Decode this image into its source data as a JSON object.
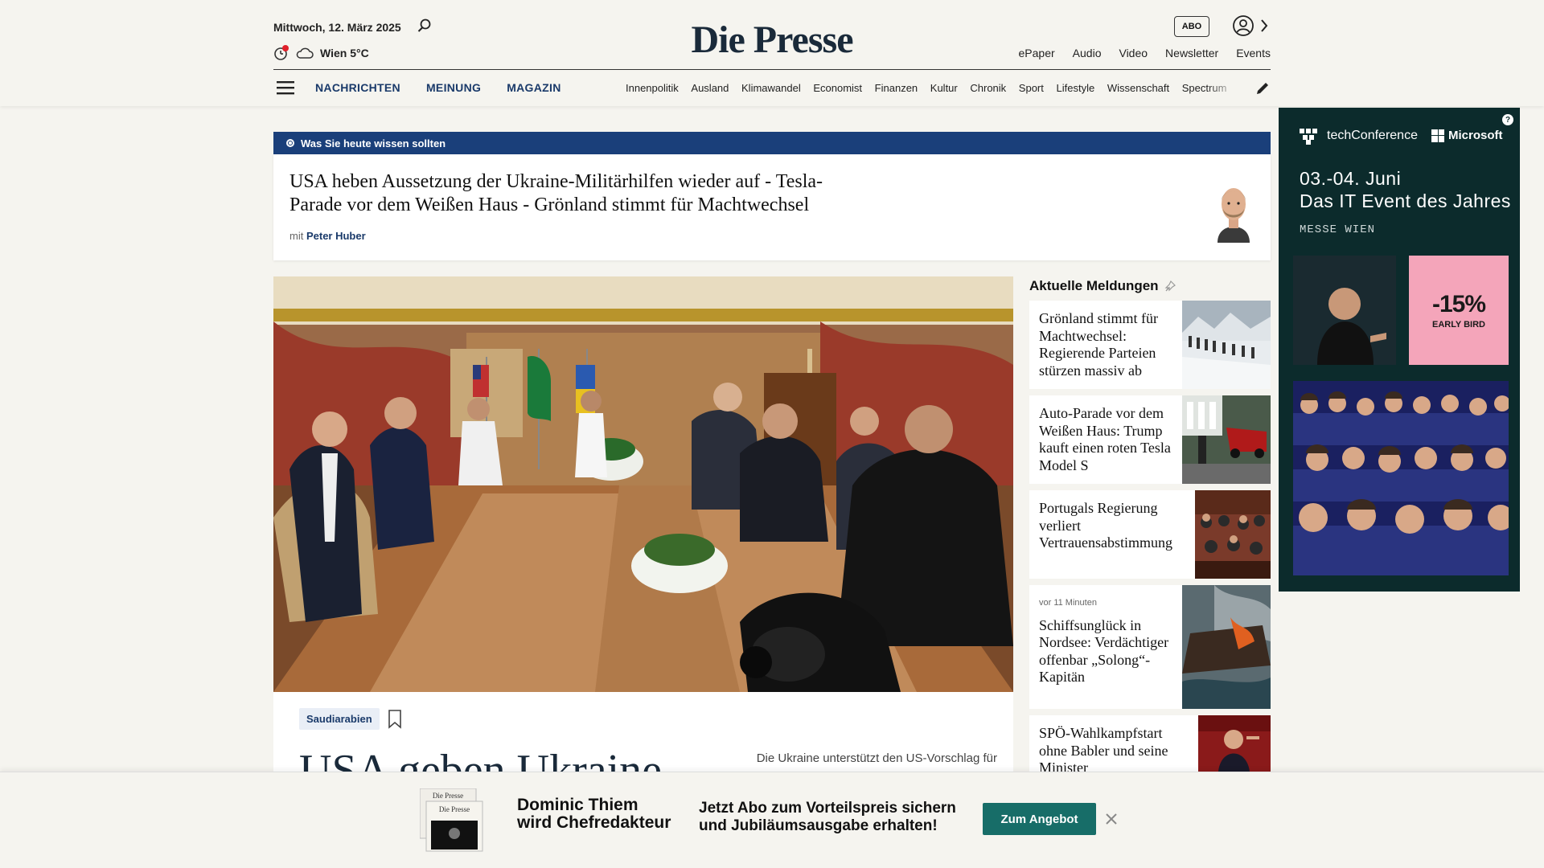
{
  "header": {
    "date": "Mittwoch, 12. März 2025",
    "weather": "Wien 5°C",
    "logo": "Die Presse",
    "abo": "ABO",
    "top_links": [
      "ePaper",
      "Audio",
      "Video",
      "Newsletter",
      "Events"
    ],
    "main_nav": [
      "NACHRICHTEN",
      "MEINUNG",
      "MAGAZIN"
    ],
    "sub_nav": [
      "Innenpolitik",
      "Ausland",
      "Klimawandel",
      "Economist",
      "Finanzen",
      "Kultur",
      "Chronik",
      "Sport",
      "Lifestyle",
      "Wissenschaft",
      "Spectrum"
    ]
  },
  "briefing": {
    "label": "Was Sie heute wissen sollten",
    "title": "USA heben Aussetzung der Ukraine-Militärhilfen wieder auf - Tesla-Parade vor dem Weißen Haus - Grönland stimmt für Machtwechsel",
    "author_prefix": "mit",
    "author": "Peter Huber"
  },
  "hero": {
    "tag": "Saudiarabien",
    "headline": "USA geben Ukraine-",
    "teaser": "Die Ukraine unterstützt den US-Vorschlag für"
  },
  "news": {
    "heading": "Aktuelle Meldungen",
    "items": [
      {
        "time": "",
        "title": "Grönland stimmt für Machtwechsel: Regierende Parteien stürzen massiv ab"
      },
      {
        "time": "",
        "title": "Auto-Parade vor dem Weißen Haus: Trump kauft einen roten Tesla Model S"
      },
      {
        "time": "",
        "title": "Portugals Regierung verliert Vertrauensabstimmung"
      },
      {
        "time": "vor 11 Minuten",
        "title": "Schiffsunglück in Nordsee: Verdächtiger offenbar „Solong“-Kapitän"
      },
      {
        "time": "",
        "title": "SPÖ-Wahlkampfstart ohne Babler und seine Minister"
      }
    ]
  },
  "ad": {
    "badge": "?",
    "brand": "techConference",
    "partner": "Microsoft",
    "date_line1": "03.-04. Juni",
    "date_line2": "Das IT Event des Jahres",
    "venue": "MESSE WIEN",
    "discount": "-15%",
    "discount_note": "EARLY BIRD"
  },
  "banner": {
    "headline_line1": "Dominic Thiem",
    "headline_line2": "wird Chefredakteur",
    "offer_line1": "Jetzt Abo zum Vorteilspreis sichern",
    "offer_line2": "und Jubiläumsausgabe erhalten!",
    "button": "Zum Angebot",
    "paper_logo": "Die Presse"
  },
  "colors": {
    "navy": "#1a3f7a",
    "ad_bg": "#0c2b2c",
    "ad_pink": "#f4a5ba",
    "button_teal": "#176d68"
  }
}
